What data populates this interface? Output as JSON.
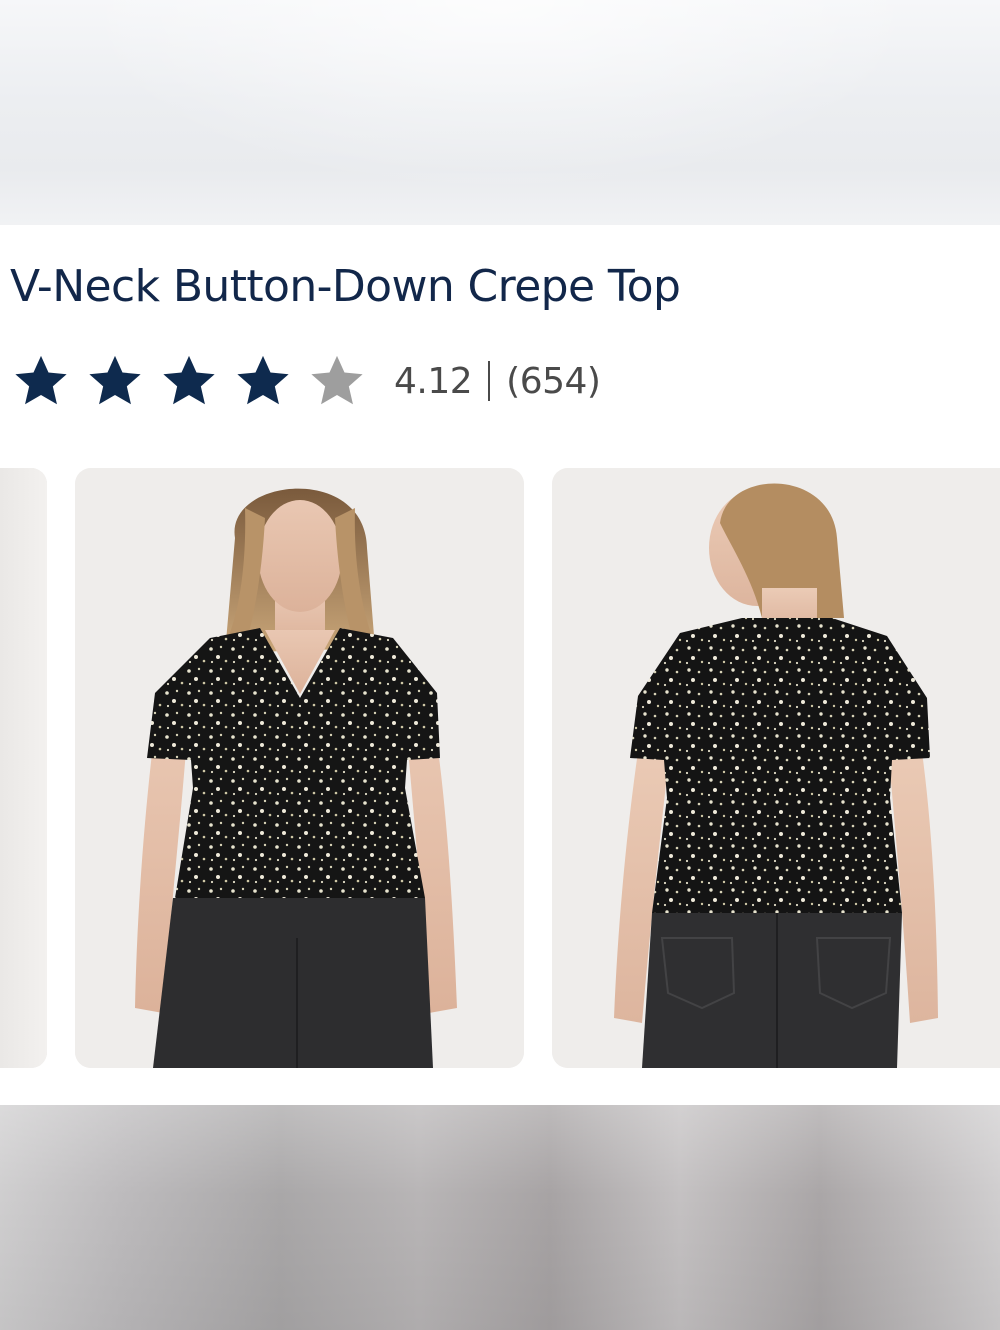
{
  "product": {
    "title": "V-Neck Button-Down Crepe Top",
    "rating": {
      "score": "4.12",
      "count": "(654)",
      "stars_filled": 4,
      "stars_total": 5,
      "filled_color": "#0e2a4e",
      "empty_color": "#9e9e9e"
    },
    "images": [
      {
        "name": "product-image-partial"
      },
      {
        "name": "product-image-front"
      },
      {
        "name": "product-image-back"
      }
    ]
  },
  "colors": {
    "title": "#12274a",
    "text_secondary": "#4a4a4a"
  }
}
